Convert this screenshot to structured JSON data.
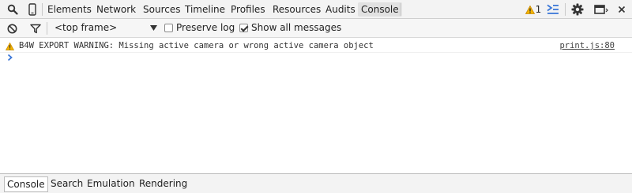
{
  "topbar": {
    "tabs": [
      "Elements",
      "Network",
      "Sources",
      "Timeline",
      "Profiles",
      "Resources",
      "Audits",
      "Console"
    ],
    "active_tab": "Console",
    "warning_count": "1",
    "icons": [
      "search-icon",
      "device-mode-icon",
      "warning-icon",
      "drawer-toggle-icon",
      "gear-icon",
      "dock-icon",
      "close-icon"
    ]
  },
  "toolbar": {
    "context_select": "<top frame>",
    "preserve_log_label": "Preserve log",
    "preserve_log_checked": false,
    "show_all_label": "Show all messages",
    "show_all_checked": true,
    "icons": [
      "clear-icon",
      "filter-icon"
    ]
  },
  "console": {
    "messages": [
      {
        "level": "warning",
        "text": "B4W EXPORT WARNING: Missing active camera or wrong active camera object",
        "source": "print.js:80"
      }
    ]
  },
  "drawer": {
    "tabs": [
      "Console",
      "Search",
      "Emulation",
      "Rendering"
    ],
    "active_tab": "Console"
  },
  "colors": {
    "warning": "#e8a000",
    "accent": "#3b77d8"
  }
}
